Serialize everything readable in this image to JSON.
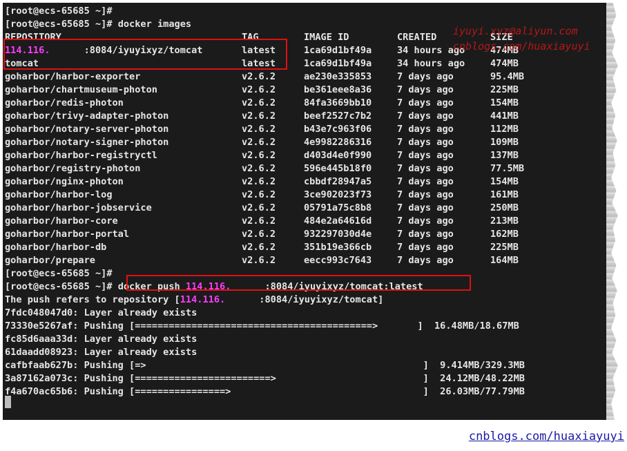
{
  "terminal": {
    "prompt": "[root@ecs-65685 ~]#",
    "command_images": "docker images",
    "headers": [
      "REPOSITORY",
      "TAG",
      "IMAGE ID",
      "CREATED",
      "SIZE"
    ],
    "images": [
      {
        "repo_ip": "114.116.",
        "repo_rest": "      :8084/iyuyixyz/tomcat",
        "tag": "latest",
        "id": "1ca69d1bf49a",
        "created": "34 hours ago",
        "size": "474MB"
      },
      {
        "repo": "tomcat",
        "tag": "latest",
        "id": "1ca69d1bf49a",
        "created": "34 hours ago",
        "size": "474MB"
      },
      {
        "repo": "goharbor/harbor-exporter",
        "tag": "v2.6.2",
        "id": "ae230e335853",
        "created": "7 days ago",
        "size": "95.4MB"
      },
      {
        "repo": "goharbor/chartmuseum-photon",
        "tag": "v2.6.2",
        "id": "be361eee8a36",
        "created": "7 days ago",
        "size": "225MB"
      },
      {
        "repo": "goharbor/redis-photon",
        "tag": "v2.6.2",
        "id": "84fa3669bb10",
        "created": "7 days ago",
        "size": "154MB"
      },
      {
        "repo": "goharbor/trivy-adapter-photon",
        "tag": "v2.6.2",
        "id": "beef2527c7b2",
        "created": "7 days ago",
        "size": "441MB"
      },
      {
        "repo": "goharbor/notary-server-photon",
        "tag": "v2.6.2",
        "id": "b43e7c963f06",
        "created": "7 days ago",
        "size": "112MB"
      },
      {
        "repo": "goharbor/notary-signer-photon",
        "tag": "v2.6.2",
        "id": "4e9982286316",
        "created": "7 days ago",
        "size": "109MB"
      },
      {
        "repo": "goharbor/harbor-registryctl",
        "tag": "v2.6.2",
        "id": "d403d4e0f990",
        "created": "7 days ago",
        "size": "137MB"
      },
      {
        "repo": "goharbor/registry-photon",
        "tag": "v2.6.2",
        "id": "596e445b18f0",
        "created": "7 days ago",
        "size": "77.5MB"
      },
      {
        "repo": "goharbor/nginx-photon",
        "tag": "v2.6.2",
        "id": "cbbdf28947a5",
        "created": "7 days ago",
        "size": "154MB"
      },
      {
        "repo": "goharbor/harbor-log",
        "tag": "v2.6.2",
        "id": "3ce902023f73",
        "created": "7 days ago",
        "size": "161MB"
      },
      {
        "repo": "goharbor/harbor-jobservice",
        "tag": "v2.6.2",
        "id": "05791a75c8b8",
        "created": "7 days ago",
        "size": "250MB"
      },
      {
        "repo": "goharbor/harbor-core",
        "tag": "v2.6.2",
        "id": "484e2a64616d",
        "created": "7 days ago",
        "size": "213MB"
      },
      {
        "repo": "goharbor/harbor-portal",
        "tag": "v2.6.2",
        "id": "932297030d4e",
        "created": "7 days ago",
        "size": "162MB"
      },
      {
        "repo": "goharbor/harbor-db",
        "tag": "v2.6.2",
        "id": "351b19e366cb",
        "created": "7 days ago",
        "size": "225MB"
      },
      {
        "repo": "goharbor/prepare",
        "tag": "v2.6.2",
        "id": "eecc993c7643",
        "created": "7 days ago",
        "size": "164MB"
      }
    ],
    "push_cmd_prefix": "docker push ",
    "push_cmd_ip": "114.116.",
    "push_cmd_suffix": "      :8084/iyuyixyz/tomcat:latest",
    "refers_prefix": "The push refers to repository [",
    "refers_ip": "114.116.",
    "refers_suffix": "      :8084/iyuyixyz/tomcat]",
    "layers": [
      "7fdc048047d0: Layer already exists",
      "73330e5267af: Pushing [==========================================>       ]  16.48MB/18.67MB",
      "fc85d6aaa33d: Layer already exists",
      "61daadd08923: Layer already exists",
      "cafbfaab627b: Pushing [=>                                                 ]  9.414MB/329.3MB",
      "3a87162a073c: Pushing [========================>                          ]  24.12MB/48.22MB",
      "f4a670ac65b6: Pushing [================>                                  ]  26.03MB/77.79MB"
    ]
  },
  "watermark": {
    "line1": "iyuyi.xyz@aliyun.com",
    "line2": "cnblogs.com/huaxiayuyi"
  },
  "footer": {
    "link": "cnblogs.com/huaxiayuyi"
  }
}
